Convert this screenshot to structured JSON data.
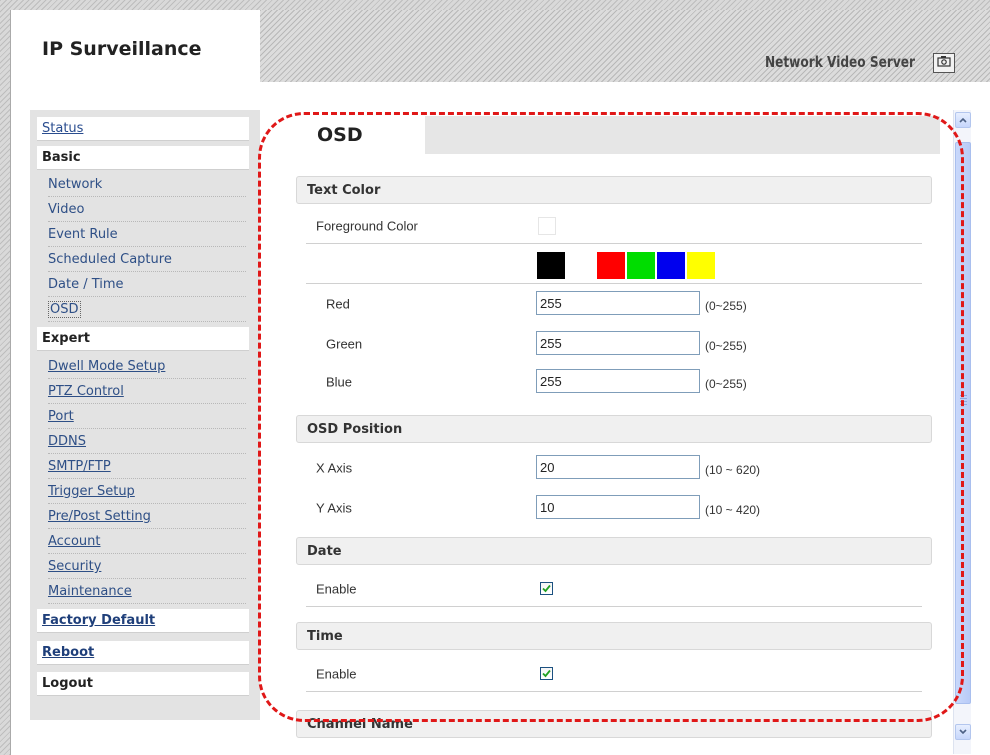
{
  "header": {
    "brand": "IP Surveillance",
    "product": "Network Video Server",
    "snapshot_icon": "camera-icon"
  },
  "sidebar": {
    "status": "Status",
    "basic": {
      "label": "Basic",
      "items": [
        "Network",
        "Video",
        "Event Rule",
        "Scheduled Capture",
        "Date / Time",
        "OSD"
      ]
    },
    "expert": {
      "label": "Expert",
      "items": [
        "Dwell Mode Setup",
        "PTZ Control",
        "Port",
        "DDNS",
        "SMTP/FTP",
        "Trigger Setup",
        "Pre/Post Setting",
        "Account",
        "Security",
        "Maintenance"
      ]
    },
    "factory_default": "Factory Default",
    "reboot": "Reboot",
    "logout": "Logout"
  },
  "main": {
    "tab_label": "OSD",
    "text_color": {
      "title": "Text Color",
      "foreground_label": "Foreground Color",
      "foreground_value": "#ffffff",
      "palette": [
        "#000000",
        "#ffffff",
        "#ff0000",
        "#00dd00",
        "#0000ee",
        "#ffff00"
      ],
      "red": {
        "label": "Red",
        "value": "255",
        "range": "(0~255)"
      },
      "green": {
        "label": "Green",
        "value": "255",
        "range": "(0~255)"
      },
      "blue": {
        "label": "Blue",
        "value": "255",
        "range": "(0~255)"
      }
    },
    "osd_position": {
      "title": "OSD Position",
      "x": {
        "label": "X Axis",
        "value": "20",
        "range": "(10 ~ 620)"
      },
      "y": {
        "label": "Y Axis",
        "value": "10",
        "range": "(10 ~ 420)"
      }
    },
    "date": {
      "title": "Date",
      "enable_label": "Enable",
      "enabled": true
    },
    "time": {
      "title": "Time",
      "enable_label": "Enable",
      "enabled": true
    },
    "channel_name": {
      "title": "Channel Name"
    }
  },
  "annotation_color": "#e01818"
}
